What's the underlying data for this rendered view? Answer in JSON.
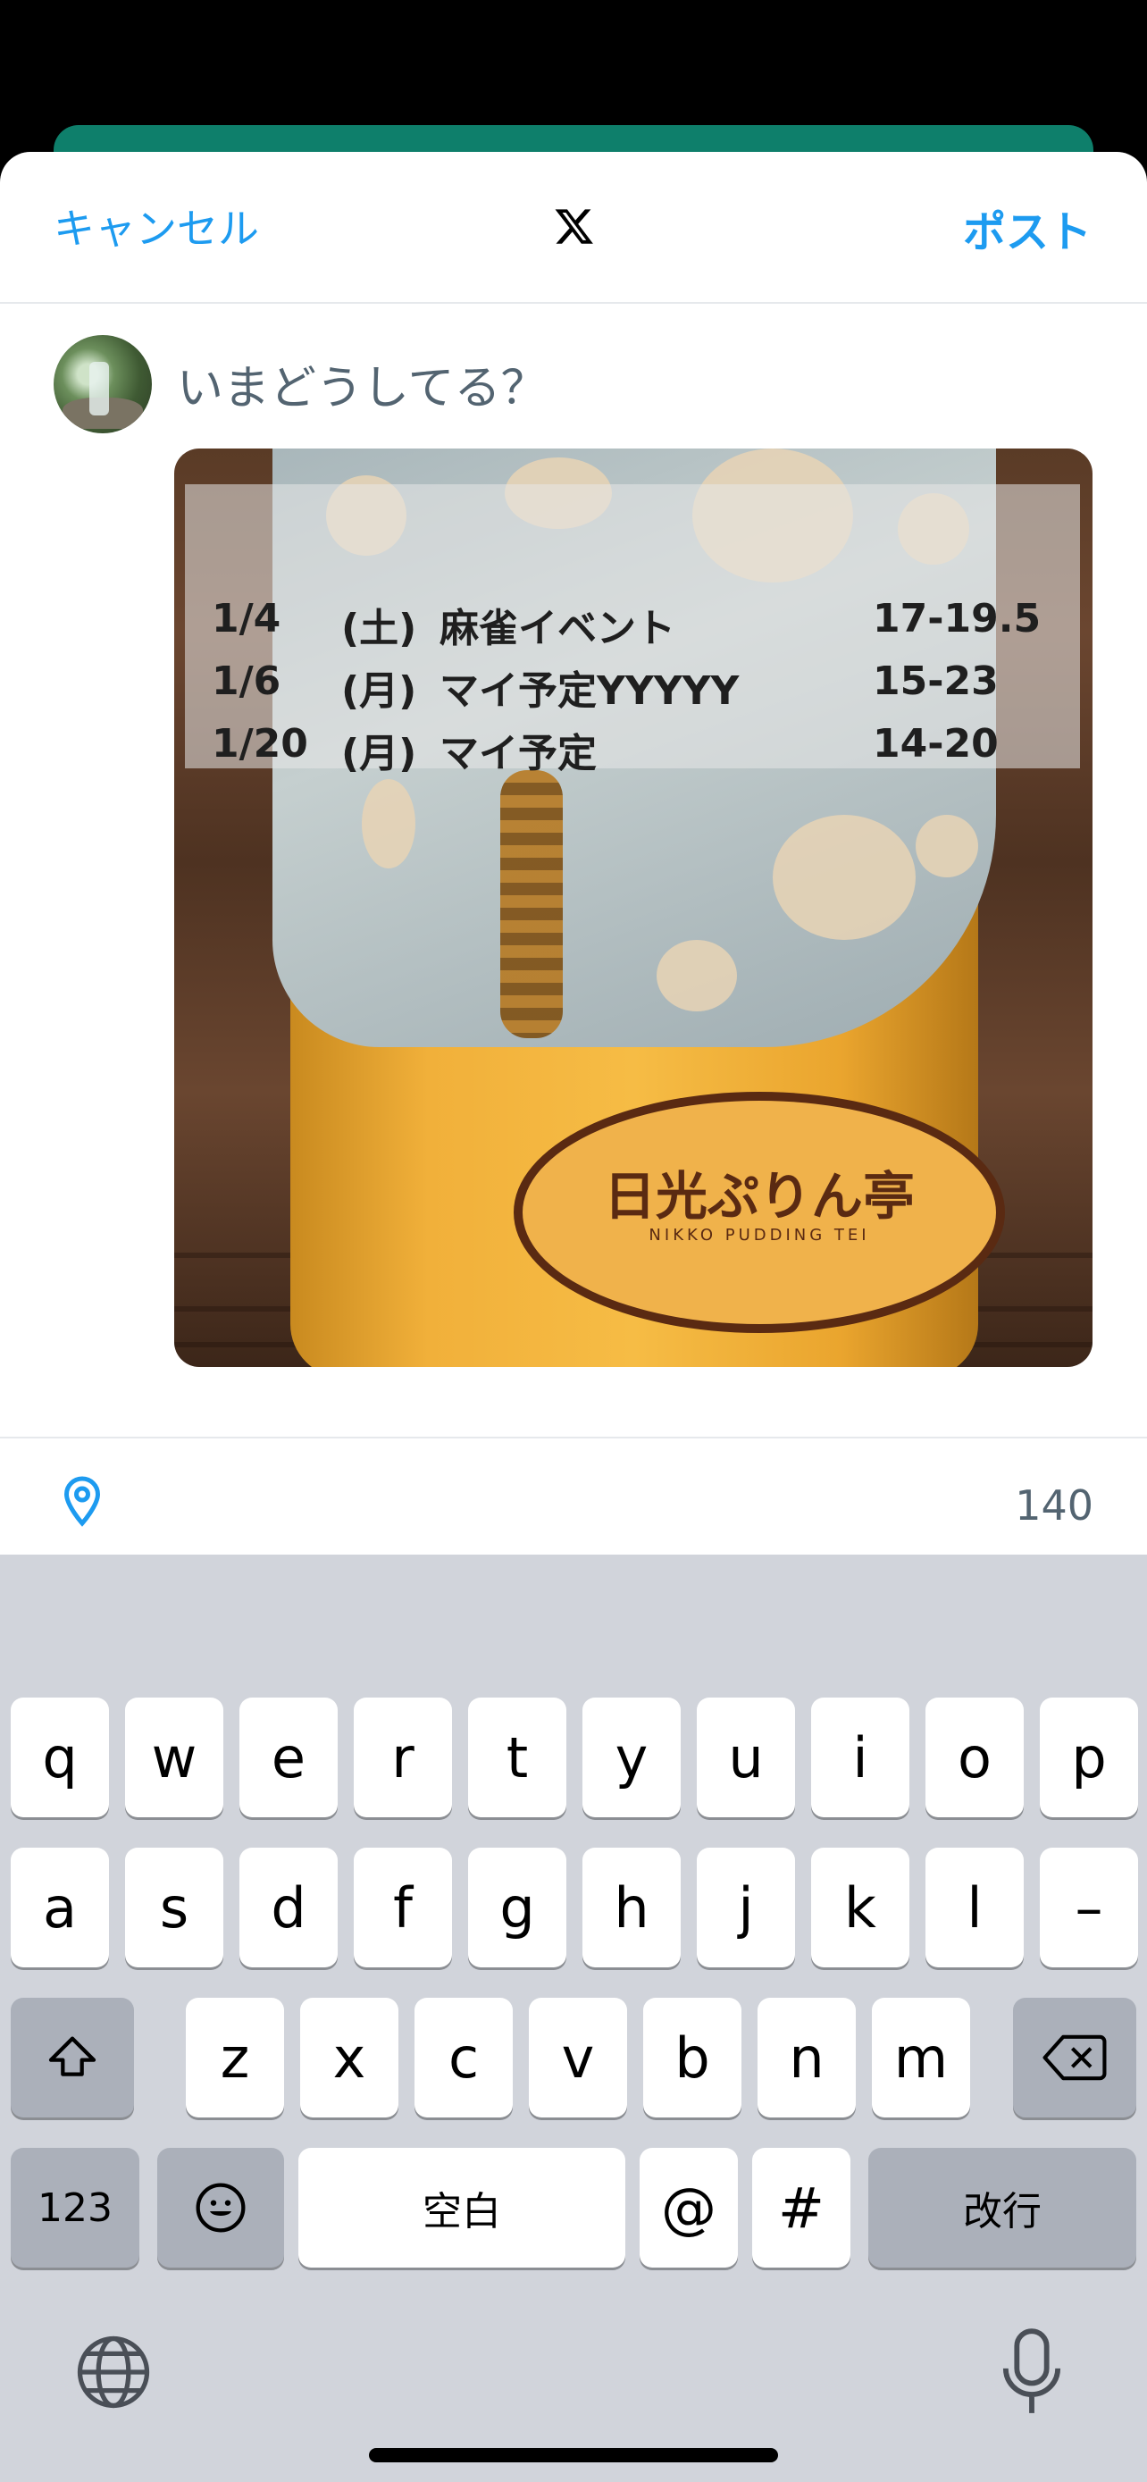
{
  "header": {
    "cancel_label": "キャンセル",
    "post_label": "ポスト",
    "logo": "x-logo-icon"
  },
  "composer": {
    "placeholder": "いまどうしてる？",
    "char_count": "140"
  },
  "photo": {
    "schedule": [
      {
        "date": "1/4",
        "weekday": "(土)",
        "event": "麻雀イベント",
        "time": "17-19.5"
      },
      {
        "date": "1/6",
        "weekday": "(月)",
        "event": "マイ予定YYYYY",
        "time": "15-23"
      },
      {
        "date": "1/20",
        "weekday": "(月)",
        "event": "マイ予定",
        "time": "14-20"
      }
    ],
    "jar_label": "日光ぷりん亭",
    "jar_sublabel": "NIKKO PUDDING TEI"
  },
  "keyboard": {
    "row1": [
      "q",
      "w",
      "e",
      "r",
      "t",
      "y",
      "u",
      "i",
      "o",
      "p"
    ],
    "row2": [
      "a",
      "s",
      "d",
      "f",
      "g",
      "h",
      "j",
      "k",
      "l",
      "–"
    ],
    "row3": [
      "z",
      "x",
      "c",
      "v",
      "b",
      "n",
      "m"
    ],
    "numbers_label": "123",
    "space_label": "空白",
    "at_label": "@",
    "hash_label": "#",
    "return_label": "改行"
  },
  "colors": {
    "accent": "#1d9bf0",
    "muted": "#536471",
    "keyboard_bg": "#d1d4db"
  }
}
